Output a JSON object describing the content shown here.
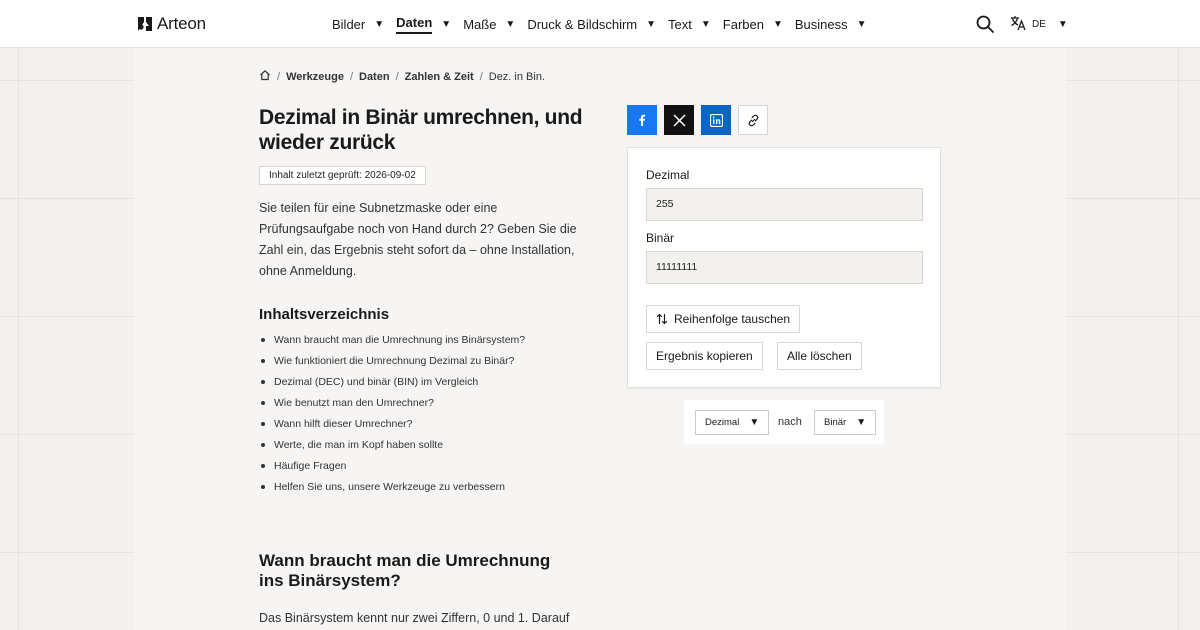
{
  "header": {
    "logo_text": "Arteon",
    "nav": [
      {
        "label": "Bilder"
      },
      {
        "label": "Daten"
      },
      {
        "label": "Maße"
      },
      {
        "label": "Druck & Bildschirm"
      },
      {
        "label": "Text"
      },
      {
        "label": "Farben"
      },
      {
        "label": "Business"
      }
    ],
    "active_nav": "Daten",
    "language": "DE",
    "icons": {
      "search": "search-icon",
      "translate": "translate-icon",
      "caret": "caret-down-icon",
      "logo": "logo-icon"
    }
  },
  "breadcrumb": {
    "home_icon": "home-icon",
    "items": [
      "Werkzeuge",
      "Daten",
      "Zahlen & Zeit"
    ],
    "current": "Dez. in Bin."
  },
  "article": {
    "title": "Dezimal in Binär umrechnen, und wieder zurück",
    "badge": "Inhalt zuletzt geprüft: 2026-09-02",
    "intro": "Sie teilen für eine Subnetzmaske oder eine Prüfungsaufgabe noch von Hand durch 2? Geben Sie die Zahl ein, das Ergebnis steht sofort da – ohne Installation, ohne Anmeldung.",
    "toc_title": "Inhaltsverzeichnis",
    "toc": [
      "Wann braucht man die Umrechnung ins Binärsystem?",
      "Wie funktioniert die Umrechnung Dezimal zu Binär?",
      "Dezimal (DEC) und binär (BIN) im Vergleich",
      "Wie benutzt man den Umrechner?",
      "Wann hilft dieser Umrechner?",
      "Werte, die man im Kopf haben sollte",
      "Häufige Fragen",
      "Helfen Sie uns, unsere Werkzeuge zu verbessern"
    ],
    "section_title": "Wann braucht man die Umrechnung ins Binärsystem?",
    "section_text": "Das Binärsystem kennt nur zwei Ziffern, 0 und 1. Darauf"
  },
  "share": {
    "facebook_icon": "facebook-icon",
    "x_icon": "x-icon",
    "linkedin_icon": "linkedin-icon",
    "link_icon": "link-icon",
    "colors": {
      "facebook": "#1877f2",
      "x": "#111111",
      "linkedin": "#0a66c2"
    }
  },
  "converter": {
    "decimal_label": "Dezimal",
    "decimal_value": "255",
    "binary_label": "Binär",
    "binary_value": "11111111",
    "swap_label": "Reihenfolge tauschen",
    "swap_icon": "swap-icon",
    "copy_label": "Ergebnis kopieren",
    "clear_label": "Alle löschen"
  },
  "unit_selector": {
    "from": "Dezimal",
    "connector": "nach",
    "to": "Binär"
  }
}
